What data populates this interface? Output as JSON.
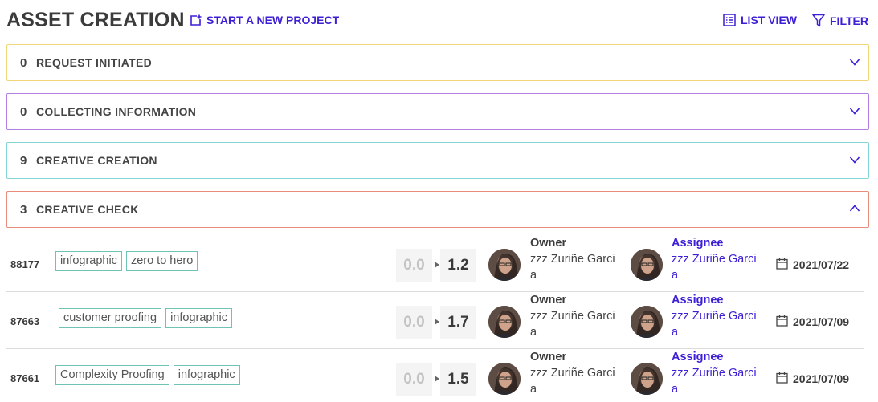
{
  "header": {
    "title": "ASSET CREATION",
    "start_project_label": "START A NEW PROJECT",
    "list_view_label": "LIST VIEW",
    "filter_label": "FILTER",
    "accent_color": "#3d1fd6"
  },
  "groups": [
    {
      "count": "0",
      "label": "REQUEST INITIATED",
      "color": "#f2d67a",
      "expanded": false
    },
    {
      "count": "0",
      "label": "COLLECTING INFORMATION",
      "color": "#b57fe0",
      "expanded": false
    },
    {
      "count": "9",
      "label": "CREATIVE CREATION",
      "color": "#86d4d4",
      "expanded": false
    },
    {
      "count": "3",
      "label": "CREATIVE CHECK",
      "color": "#e88c7c",
      "expanded": true
    }
  ],
  "rows": [
    {
      "id": "88177",
      "tags": [
        "infographic",
        "zero to hero"
      ],
      "version_from": "0.0",
      "version_to": "1.2",
      "owner_label": "Owner",
      "owner_name": "zzz Zuriñe Garcia",
      "assignee_label": "Assignee",
      "assignee_name": "zzz Zuriñe Garcia",
      "date": "2021/07/22"
    },
    {
      "id": "87663",
      "tags": [
        "customer proofing",
        "infographic"
      ],
      "version_from": "0.0",
      "version_to": "1.7",
      "owner_label": "Owner",
      "owner_name": "zzz Zuriñe Garcia",
      "assignee_label": "Assignee",
      "assignee_name": "zzz Zuriñe Garcia",
      "date": "2021/07/09"
    },
    {
      "id": "87661",
      "tags": [
        "Complexity Proofing",
        "infographic"
      ],
      "version_from": "0.0",
      "version_to": "1.5",
      "owner_label": "Owner",
      "owner_name": "zzz Zuriñe Garcia",
      "assignee_label": "Assignee",
      "assignee_name": "zzz Zuriñe Garcia",
      "date": "2021/07/09"
    }
  ]
}
